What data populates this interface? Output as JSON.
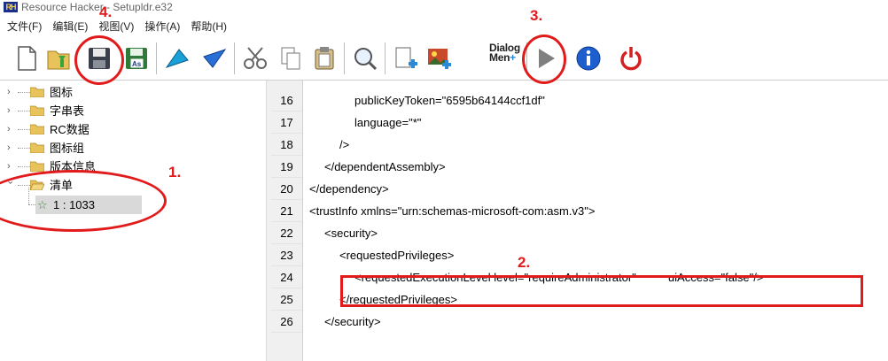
{
  "window": {
    "logo_text": "RH",
    "title": "Resource Hacker - Setupldr.e32"
  },
  "menu": [
    "文件(F)",
    "编辑(E)",
    "视图(V)",
    "操作(A)",
    "帮助(H)"
  ],
  "toolbar": {
    "buttons": [
      "new-file",
      "open-folder",
      "save",
      "save-as",
      "arrow-up-left",
      "arrow-down-left",
      "cut",
      "copy",
      "paste",
      "search",
      "add-resource",
      "add-image",
      "dialog-menu",
      "run",
      "info",
      "power"
    ],
    "dialog_menu_label_line1": "Dialog",
    "dialog_menu_label_line2": "Men"
  },
  "tree": {
    "items": [
      {
        "label": "图标",
        "expanded": false
      },
      {
        "label": "字串表",
        "expanded": false
      },
      {
        "label": "RC数据",
        "expanded": false
      },
      {
        "label": "图标组",
        "expanded": false
      },
      {
        "label": "版本信息",
        "expanded": false
      },
      {
        "label": "清单",
        "expanded": true
      }
    ],
    "selected_leaf": "1 : 1033"
  },
  "editor": {
    "lines": [
      {
        "num": "16",
        "text": "publicKeyToken=\"6595b64144ccf1df\""
      },
      {
        "num": "17",
        "text": "language=\"*\""
      },
      {
        "num": "18",
        "text": "/>"
      },
      {
        "num": "19",
        "text": "</dependentAssembly>"
      },
      {
        "num": "20",
        "text": "</dependency>"
      },
      {
        "num": "21",
        "text": "<trustInfo xmlns=\"urn:schemas-microsoft-com:asm.v3\">"
      },
      {
        "num": "22",
        "text": "<security>"
      },
      {
        "num": "23",
        "text": "<requestedPrivileges>"
      },
      {
        "num": "24",
        "text": "<requestedExecutionLevel level=\"requireAdministrator\"          uiAccess=\"false\"/>"
      },
      {
        "num": "25",
        "text": "</requestedPrivileges>"
      },
      {
        "num": "26",
        "text": "</security>"
      }
    ]
  },
  "annotations": {
    "step1": "1.",
    "step2": "2.",
    "step3": "3.",
    "step4": "4.",
    "color": "#e11b1b"
  }
}
